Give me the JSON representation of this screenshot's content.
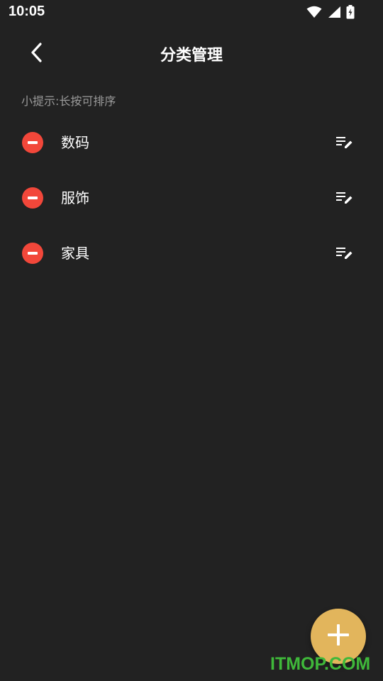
{
  "status_bar": {
    "time": "10:05",
    "icons": [
      "wifi-icon",
      "signal-icon",
      "battery-charging-icon"
    ]
  },
  "app_bar": {
    "back_icon": "chevron-left-icon",
    "title": "分类管理"
  },
  "hint": "小提示:长按可排序",
  "categories": [
    {
      "label": "数码",
      "remove_icon": "remove-circle-icon",
      "edit_icon": "edit-list-icon"
    },
    {
      "label": "服饰",
      "remove_icon": "remove-circle-icon",
      "edit_icon": "edit-list-icon"
    },
    {
      "label": "家具",
      "remove_icon": "remove-circle-icon",
      "edit_icon": "edit-list-icon"
    }
  ],
  "fab": {
    "icon": "plus-icon"
  },
  "watermark": "ITMOP.COM",
  "colors": {
    "background": "#222222",
    "remove": "#f2473a",
    "fab": "#e2b55c",
    "hint_text": "#9a9a9a",
    "watermark": "#3fb83a"
  }
}
